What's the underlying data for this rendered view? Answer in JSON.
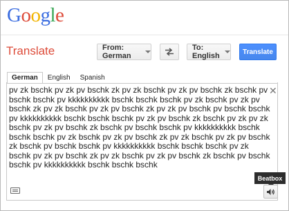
{
  "logo": {
    "letters": [
      "G",
      "o",
      "o",
      "g",
      "l",
      "e"
    ],
    "colors": [
      "#3b6de0",
      "#dd4b39",
      "#f2b400",
      "#3b6de0",
      "#3aa757",
      "#dd4b39"
    ]
  },
  "header": {
    "title": "Translate"
  },
  "toolbar": {
    "from_label": "From: German",
    "swap_icon": "swap-arrows-icon",
    "to_label": "To: English",
    "translate_label": "Translate"
  },
  "source_tabs": [
    {
      "label": "German",
      "active": true
    },
    {
      "label": "English",
      "active": false
    },
    {
      "label": "Spanish",
      "active": false
    }
  ],
  "input": {
    "text": "pv zk bschk pv zk pv bschk zk pv zk bschk pv zk pv bschk zk bschk pv bschk bschk pv kkkkkkkkkk bschk bschk bschk pv zk bschk pv zk pv bschk zk pv zk bschk pv zk pv bschk zk pv zk pv bschk pv bschk bschk pv kkkkkkkkkk bschk bschk bschk pv zk pv bschk zk bschk pv zk pv zk bschk pv zk pv bschk zk bschk pv bschk bschk pv kkkkkkkkkk bschk bschk bschk pv zk bschk pv zk pv bschk zk pv zk bschk pv zk pv bschk zk bschk pv bschk bschk pv kkkkkkkkkk bschk bschk bschk pv zk bschk pv zk pv bschk zk pv zk bschk pv zk pv bschk zk bschk pv bschk bschk pv kkkkkkkkkk bschk bschk bschk",
    "close_icon": "close-icon",
    "keyboard_icon": "keyboard-icon",
    "speaker_icon": "speaker-icon"
  },
  "tooltip": {
    "label": "Beatbox"
  }
}
